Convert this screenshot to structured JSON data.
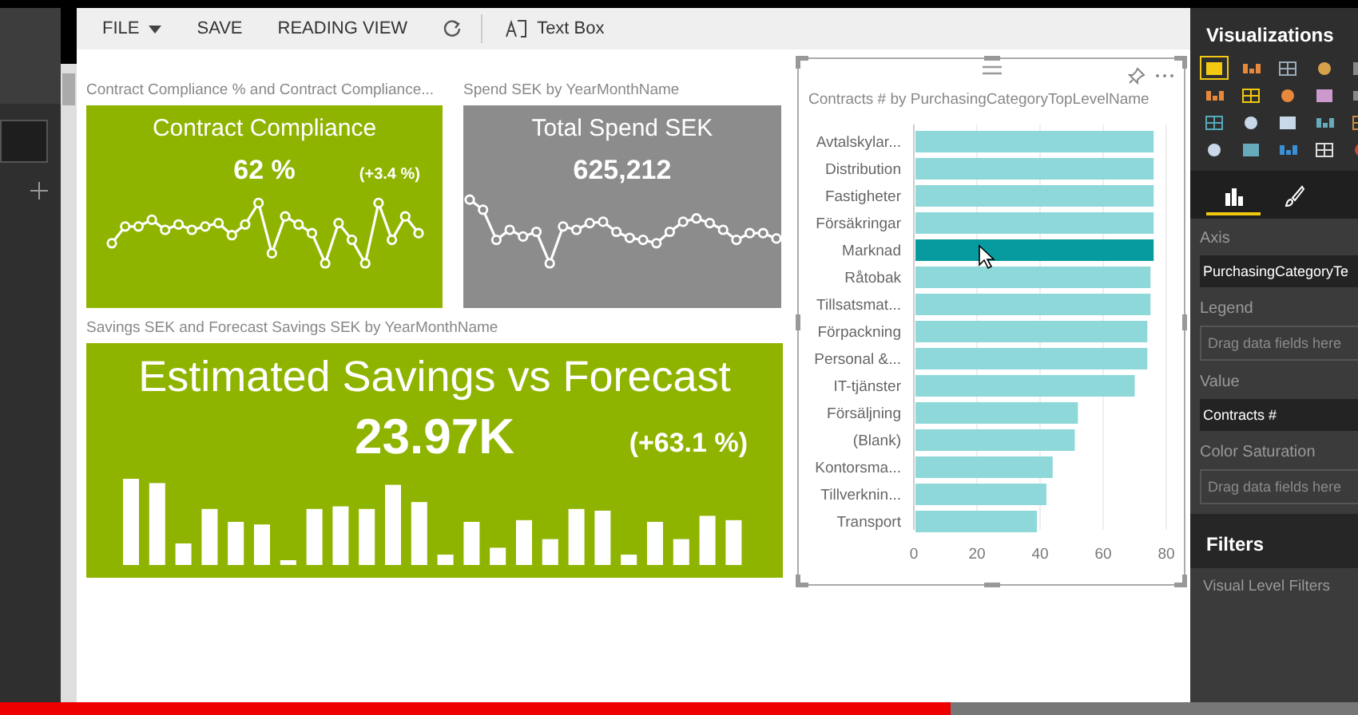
{
  "toolbar": {
    "items": [
      {
        "kind": "menu",
        "label": "FILE"
      },
      {
        "kind": "text",
        "label": "SAVE"
      },
      {
        "kind": "text",
        "label": "READING VIEW"
      },
      {
        "kind": "refresh"
      },
      {
        "kind": "textbox",
        "label": "Text Box"
      }
    ]
  },
  "canvas": {
    "cards": [
      {
        "kind": "line",
        "title": "Contract Compliance % and Contract Compliance...",
        "color": "#8fb400",
        "heading": "Contract Compliance",
        "value": "62 %",
        "change": "(+3.4 %)"
      },
      {
        "kind": "line",
        "title": "Spend SEK by YearMonthName",
        "color": "#8c8c8c",
        "heading": "Total Spend SEK",
        "value": "625,212"
      },
      {
        "kind": "bars",
        "title": "Savings SEK and Forecast Savings SEK by YearMonthName",
        "color": "#8fb400",
        "heading": "Estimated Savings vs Forecast",
        "value": "23.97K",
        "change": "(+63.1 %)"
      }
    ],
    "bar_chart": {
      "title": "Contracts # by PurchasingCategoryTopLevelName",
      "chart_data": {
        "type": "bar",
        "orientation": "horizontal",
        "categories": [
          "Avtalskylar...",
          "Distribution",
          "Fastigheter",
          "Försäkringar",
          "Marknad",
          "Råtobak",
          "Tillsatsmat...",
          "Förpackning",
          "Personal &...",
          "IT-tjänster",
          "Försäljning",
          "(Blank)",
          "Kontorsma...",
          "Tillverknin...",
          "Transport"
        ],
        "series": [
          {
            "color": "#8ed8da",
            "values": [
              76,
              76,
              76,
              76,
              null,
              75,
              75,
              74,
              74,
              70,
              52,
              51,
              44,
              42,
              39
            ]
          },
          {
            "color": "#079ba0",
            "values": [
              null,
              null,
              null,
              null,
              76,
              null,
              null,
              null,
              null,
              null,
              null,
              null,
              null,
              null,
              null
            ]
          }
        ],
        "grid": true,
        "xlim": [
          0,
          80
        ],
        "xticks": [
          0,
          20,
          40,
          60,
          80
        ]
      }
    }
  },
  "visualizations": {
    "title": "Visualizations",
    "types": [
      {
        "selected": true
      },
      {
        "selected": false
      },
      {
        "selected": false
      },
      {
        "selected": false
      },
      {
        "selected": false
      },
      {
        "selected": false
      },
      {
        "selected": false
      },
      {
        "selected": false
      },
      {
        "selected": false
      },
      {
        "selected": false
      },
      {
        "selected": false
      },
      {
        "selected": false
      },
      {
        "selected": false
      },
      {
        "selected": false
      },
      {
        "selected": false
      },
      {
        "selected": false
      },
      {
        "selected": false
      },
      {
        "selected": false
      },
      {
        "selected": false
      },
      {
        "selected": false
      }
    ],
    "panes": [
      {
        "kind": "fields",
        "selected": true
      },
      {
        "kind": "format",
        "selected": false
      }
    ],
    "wells": [
      {
        "label": "Axis",
        "value": "PurchasingCategoryTe"
      },
      {
        "label": "Legend",
        "placeholder": "Drag data fields here"
      },
      {
        "label": "Value",
        "value": "Contracts #"
      },
      {
        "label": "Color Saturation",
        "placeholder": "Drag data fields here"
      }
    ]
  },
  "filters": {
    "title": "Filters",
    "sections": [
      "Visual Level Filters"
    ]
  },
  "video_progress": {
    "level": 0.7
  }
}
